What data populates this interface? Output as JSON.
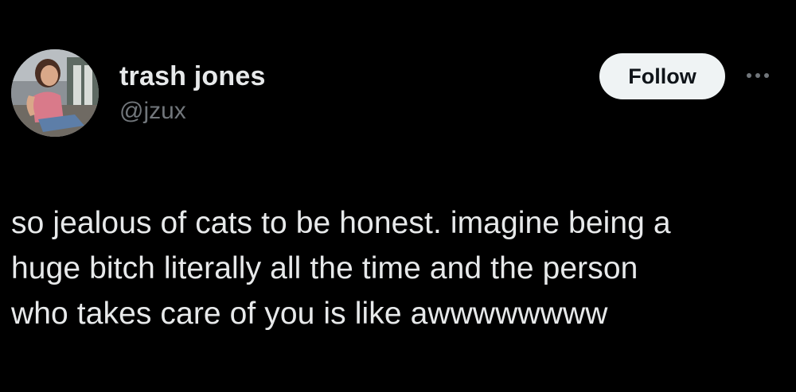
{
  "author": {
    "display_name": "trash jones",
    "handle": "@jzux"
  },
  "actions": {
    "follow_label": "Follow",
    "more_icon": "more-horizontal-icon"
  },
  "tweet": {
    "lines": [
      "so jealous of cats to be honest. imagine being a",
      "huge bitch literally all the time and the person",
      "who takes care of you is like awwwwwwww"
    ]
  },
  "colors": {
    "background": "#000000",
    "primary_text": "#e7e9ea",
    "secondary_text": "#71767b",
    "follow_button_bg": "#eff3f4",
    "follow_button_text": "#0f1419"
  }
}
